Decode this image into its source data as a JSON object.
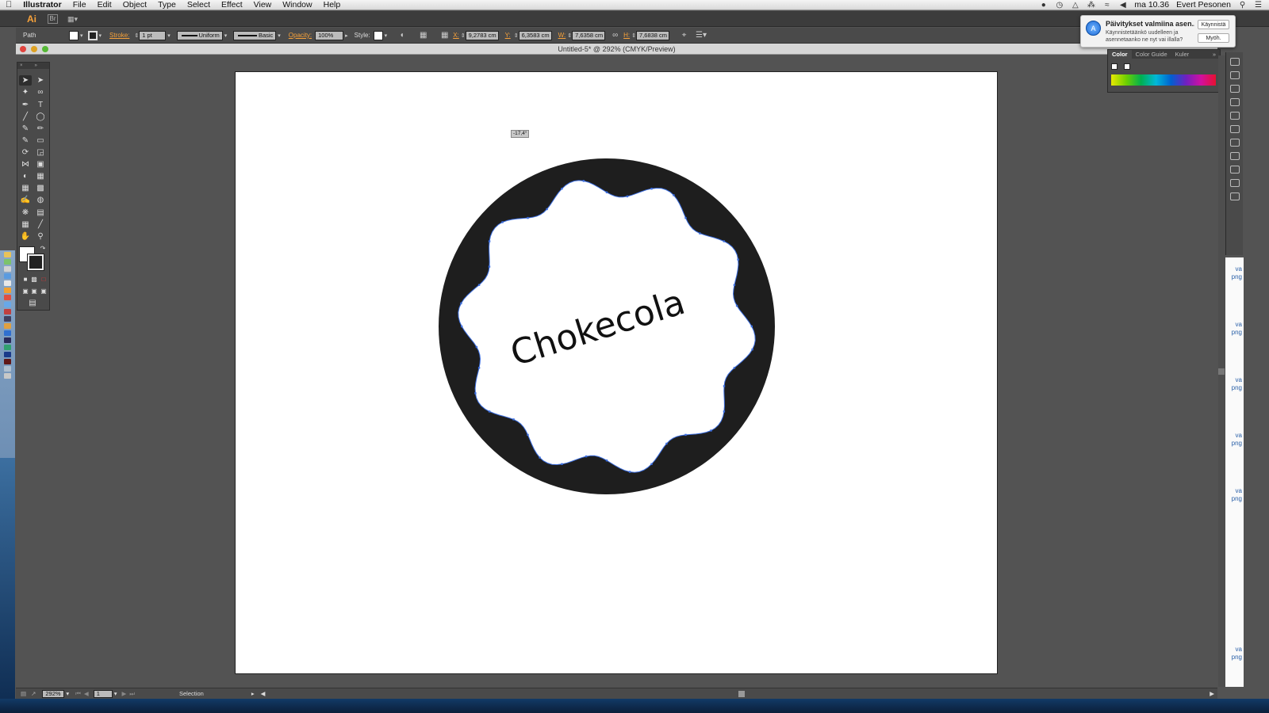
{
  "menubar": {
    "apple": "",
    "app": "Illustrator",
    "items": [
      "File",
      "Edit",
      "Object",
      "Type",
      "Select",
      "Effect",
      "View",
      "Window",
      "Help"
    ],
    "clock": "ma 10.36",
    "user": "Evert Pesonen"
  },
  "appbar": {
    "logo": "Ai",
    "bridge": "Br"
  },
  "controlbar": {
    "selection_type": "Path",
    "stroke_label": "Stroke:",
    "stroke_weight": "1 pt",
    "profile": "Uniform",
    "brush": "Basic",
    "opacity_label": "Opacity:",
    "opacity": "100%",
    "style_label": "Style:",
    "x_label": "X:",
    "x": "9,2783 cm",
    "y_label": "Y:",
    "y": "6,3583 cm",
    "w_label": "W:",
    "w": "7,6358 cm",
    "h_label": "H:",
    "h": "7,6838 cm"
  },
  "document": {
    "title": "Untitled-5* @ 292% (CMYK/Preview)"
  },
  "canvas": {
    "text": "Chokecola",
    "rotate_angle": "-17,4°",
    "text_rotation_deg": -17.4
  },
  "notification": {
    "title": "Päivitykset valmiina asen...",
    "body": "Käynnistetäänkö uudelleen ja asennetaanko ne nyt vai illalla?",
    "primary": "Käynnistä",
    "secondary": "Myöh."
  },
  "color_panel": {
    "tabs": [
      "Color",
      "Color Guide",
      "Kuler"
    ]
  },
  "statusbar": {
    "zoom": "292%",
    "page": "1",
    "tool": "Selection"
  },
  "finder_labels": [
    "va",
    "png",
    "va",
    "png",
    "va",
    "png",
    "va",
    "png",
    "va",
    "png",
    "va",
    "png"
  ],
  "colors": {
    "accent": "#f7a23b",
    "shape": "#1e1e1e",
    "path_select": "#3d6fe0"
  }
}
